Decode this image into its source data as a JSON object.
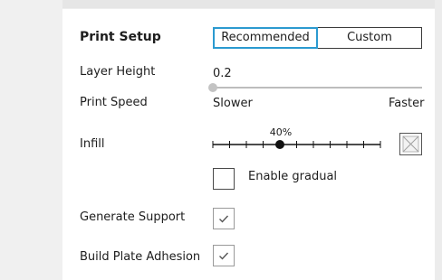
{
  "print_setup": {
    "title": "Print Setup",
    "tabs": {
      "recommended": "Recommended",
      "custom": "Custom"
    },
    "layer_height": {
      "label": "Layer Height",
      "value": "0.2"
    },
    "print_speed": {
      "label": "Print Speed",
      "min_label": "Slower",
      "max_label": "Faster",
      "position": 0
    },
    "infill": {
      "label": "Infill",
      "percent_label": "40%",
      "percent": 40,
      "icon": "infill-pattern-icon"
    },
    "gradual": {
      "label": "Enable gradual",
      "checked": false
    },
    "generate_support": {
      "label": "Generate Support",
      "checked": true
    },
    "build_plate_adhesion": {
      "label": "Build Plate Adhesion",
      "checked": true
    }
  },
  "colors": {
    "accent": "#2b9ad0",
    "panel_bg": "#ffffff",
    "window_bg": "#eeeeee"
  }
}
